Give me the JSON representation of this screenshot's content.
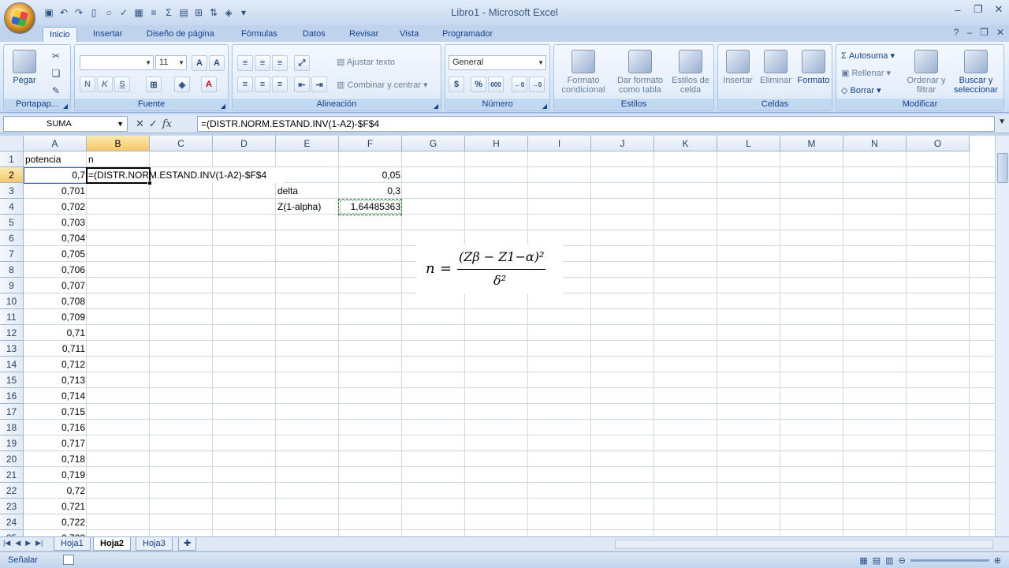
{
  "window": {
    "title": "Libro1 - Microsoft Excel"
  },
  "tabs": [
    "Inicio",
    "Insertar",
    "Diseño de página",
    "Fórmulas",
    "Datos",
    "Revisar",
    "Vista",
    "Programador"
  ],
  "ribbon": {
    "portapapeles": {
      "title": "Portapap...",
      "pegar": "Pegar"
    },
    "fuente": {
      "title": "Fuente",
      "font_name": "",
      "font_size": "11",
      "bold": "N",
      "italic": "K",
      "underline": "S"
    },
    "alineacion": {
      "title": "Alineación",
      "ajustar": "Ajustar texto",
      "combinar": "Combinar y centrar"
    },
    "numero": {
      "title": "Número",
      "format": "General",
      "currency": "$",
      "percent": "%",
      "thousands": "000"
    },
    "estilos": {
      "title": "Estilos",
      "formato_condicional": "Formato condicional",
      "dar_formato": "Dar formato como tabla",
      "estilos_celda": "Estilos de celda"
    },
    "celdas": {
      "title": "Celdas",
      "insertar": "Insertar",
      "eliminar": "Eliminar",
      "formato": "Formato"
    },
    "modificar": {
      "title": "Modificar",
      "autosuma": "Autosuma",
      "rellenar": "Rellenar",
      "borrar": "Borrar",
      "ordenar": "Ordenar y filtrar",
      "buscar": "Buscar y seleccionar"
    }
  },
  "formula_bar": {
    "name_box": "SUMA",
    "formula": "=(DISTR.NORM.ESTAND.INV(1-A2)-$F$4"
  },
  "columns": [
    "A",
    "B",
    "C",
    "D",
    "E",
    "F",
    "G",
    "H",
    "I",
    "J",
    "K",
    "L",
    "M",
    "N",
    "O"
  ],
  "rows": [
    "1",
    "2",
    "3",
    "4",
    "5",
    "6",
    "7",
    "8",
    "9",
    "10",
    "11",
    "12",
    "13",
    "14",
    "15",
    "16",
    "17",
    "18",
    "19",
    "20",
    "21",
    "22",
    "23",
    "24",
    "25"
  ],
  "cells": {
    "A1": "potencia",
    "B1": "n",
    "B2_edit": "=(DISTR.NORM.ESTAND.INV(1-A2)-$F$4",
    "E3": "delta",
    "E4": "Z(1-alpha)",
    "F2": "0,05",
    "F3": "0,3",
    "F4": "1,64485363",
    "A_values": [
      "0,7",
      "0,701",
      "0,702",
      "0,703",
      "0,704",
      "0,705",
      "0,706",
      "0,707",
      "0,708",
      "0,709",
      "0,71",
      "0,711",
      "0,712",
      "0,713",
      "0,714",
      "0,715",
      "0,716",
      "0,717",
      "0,718",
      "0,719",
      "0,72",
      "0,721",
      "0,722",
      "0,723"
    ]
  },
  "equation": {
    "lhs": "n",
    "eq": "=",
    "numerator": "(Zβ − Z1−α)²",
    "denominator": "δ²"
  },
  "sheets": [
    "Hoja1",
    "Hoja2",
    "Hoja3"
  ],
  "active_sheet": "Hoja2",
  "status": {
    "mode": "Señalar"
  }
}
